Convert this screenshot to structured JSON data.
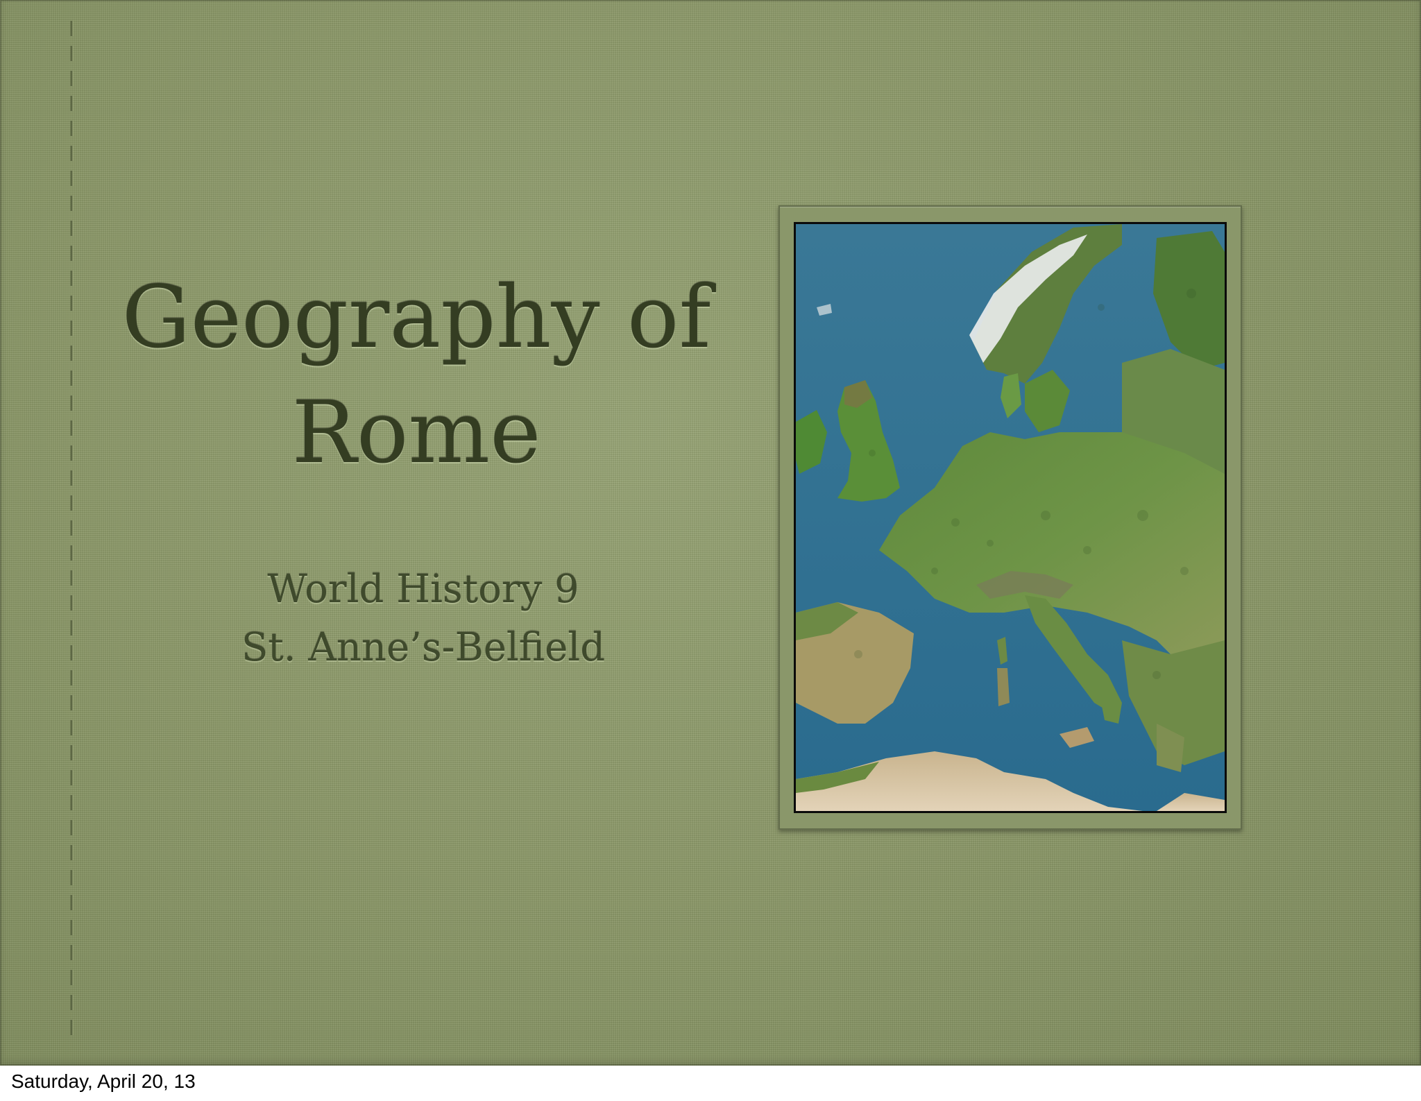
{
  "slide": {
    "title_lines": [
      "Geography of",
      "Rome"
    ],
    "subtitle_lines": [
      "World History 9",
      "St. Anne’s-Belfield"
    ],
    "background_color": "#8d9a6a",
    "title_color": "#343d22",
    "image_subject": "europe-satellite-map-image"
  },
  "footer": {
    "date": "Saturday, April 20, 13"
  }
}
